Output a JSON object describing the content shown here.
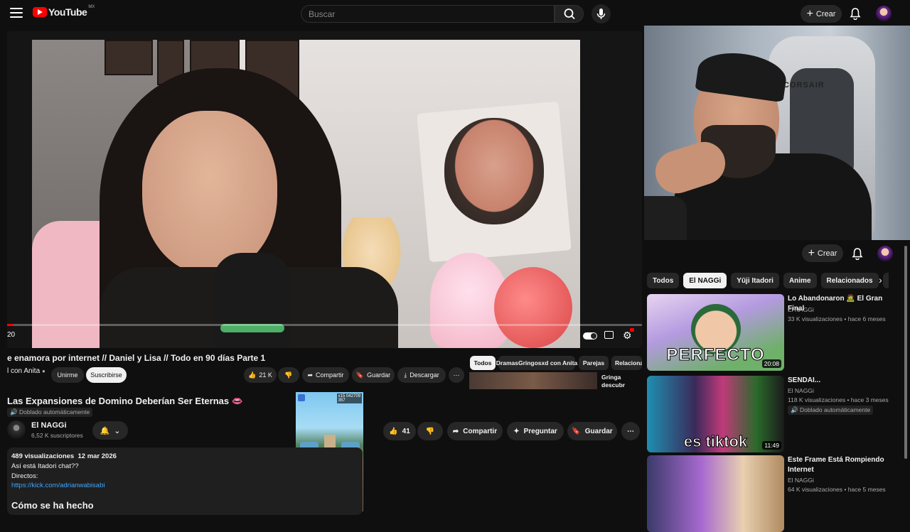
{
  "topbar": {
    "logo_text": "YouTube",
    "country_code": "MX",
    "search_placeholder": "Buscar",
    "create_label": "Crear"
  },
  "player": {
    "time_current": "20",
    "progress_fraction": 0.01
  },
  "embedded": {
    "title": "e enamora por internet // Daniel y Lisa // Todo en 90 días Parte 1",
    "channel": "l con Anita",
    "join_label": "Unirme",
    "subscribe_label": "Suscribirse",
    "likes": "21 K",
    "share_label": "Compartir",
    "save_label": "Guardar",
    "download_label": "Descargar",
    "tabs": [
      "Todos",
      "DramasGringosxd con Anita",
      "Parejas",
      "Relaciona"
    ],
    "rec_title": "Gringa descubr Nigeriano la est"
  },
  "video": {
    "title": "Las Expansiones de Domino Deberían Ser Eternas",
    "dubbed_label": "Doblado automáticamente",
    "channel_name": "El NAGGi",
    "subscribers": "6,52 K suscriptores",
    "likes": "41",
    "share_label": "Compartir",
    "ask_label": "Preguntar",
    "save_label": "Guardar",
    "views": "489 visualizaciones",
    "date": "12 mar 2026",
    "desc_line1": "Así está Itadori chat??",
    "desc_line2": "Directos:",
    "desc_link": "https://kick.com/adrianwabisabi",
    "desc_heading": "Cómo se ha hecho",
    "game_score": "042709",
    "game_coins": "357",
    "game_mult": "x15"
  },
  "webcam": {
    "chair_brand": "CORSAIR"
  },
  "sidebar": {
    "create_label": "Crear",
    "chips": [
      "Todos",
      "El NAGGi",
      "Yūji Itadori",
      "Anime",
      "Relacionados",
      "P"
    ],
    "active_chip": "El NAGGi",
    "recommendations": [
      {
        "title": "Lo Abandonaron 🧟 El Gran Final",
        "channel": "El NAGGi",
        "meta": "33 K visualizaciones • hace 6 meses",
        "duration": "20:08",
        "thumb_text": "PERFECTO"
      },
      {
        "title": "SENDAI...",
        "channel": "El NAGGi",
        "meta": "118 K visualizaciones • hace 3 meses",
        "badge": "Doblado automáticamente",
        "duration": "11:49",
        "thumb_text": "es tiktok"
      },
      {
        "title": "Este Frame Está Rompiendo Internet",
        "channel": "El NAGGi",
        "meta": "64 K visualizaciones • hace 5 meses"
      }
    ]
  },
  "colors": {
    "bg": "#0f0f0f",
    "accent_red": "#ff0000",
    "link_blue": "#3ea6ff",
    "pill_bg": "#272727"
  }
}
